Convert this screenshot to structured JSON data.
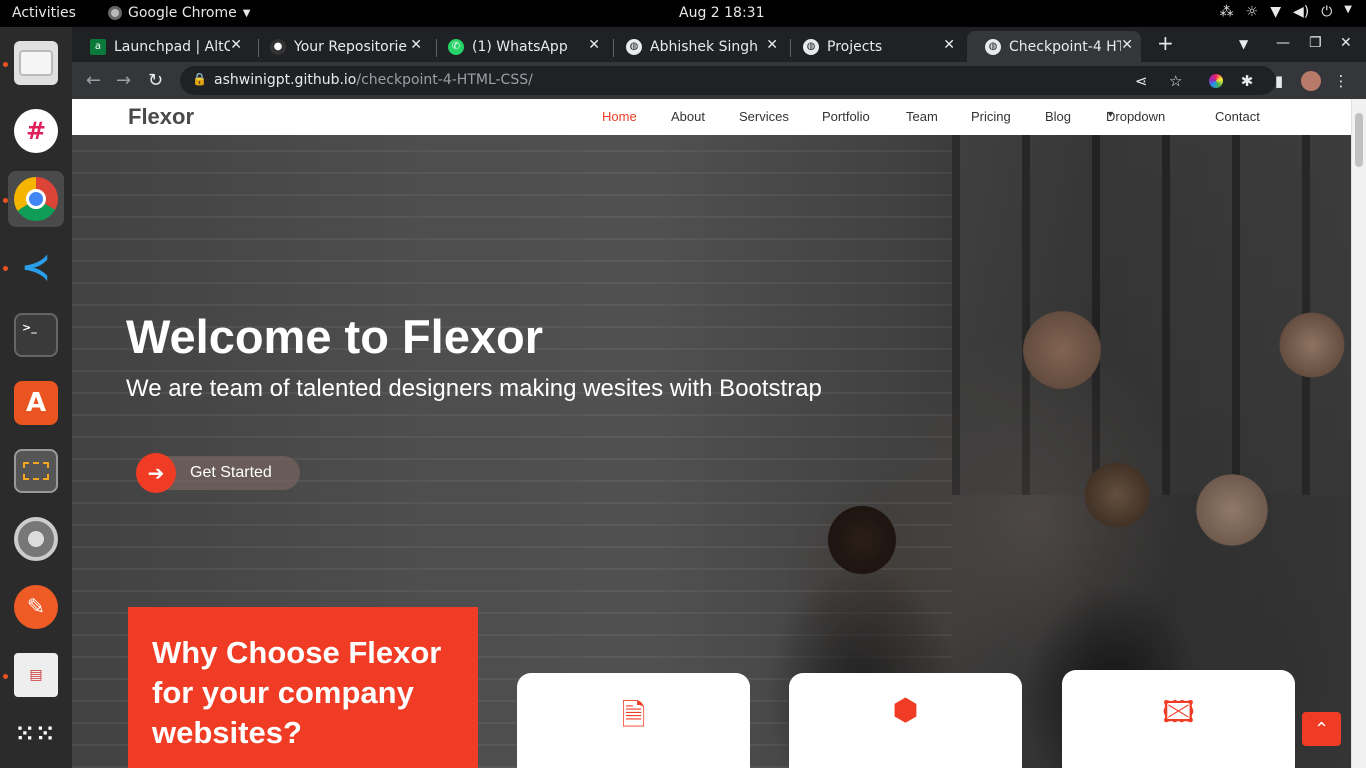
{
  "os": {
    "activities": "Activities",
    "app_name": "Google Chrome",
    "clock": "Aug 2  18:31"
  },
  "dock": {
    "apps": [
      "files-icon",
      "slack-icon",
      "chrome-icon",
      "vscode-icon",
      "terminal-icon",
      "software-store-icon",
      "screenshot-icon",
      "settings-icon",
      "postman-icon",
      "document-viewer-icon",
      "app-grid-icon"
    ]
  },
  "browser": {
    "tabs": [
      {
        "title": "Launchpad | AltC",
        "icon": "chart-icon"
      },
      {
        "title": "Your Repositorie",
        "icon": "github-icon"
      },
      {
        "title": "(1) WhatsApp",
        "icon": "whatsapp-icon"
      },
      {
        "title": "Abhishek Singh",
        "icon": "globe-icon"
      },
      {
        "title": "Projects",
        "icon": "globe-icon"
      },
      {
        "title": "Checkpoint-4 HT",
        "icon": "globe-icon"
      }
    ],
    "url_host": "ashwinigpt.github.io",
    "url_path": "/checkpoint-4-HTML-CSS/"
  },
  "site": {
    "logo": "Flexor",
    "nav": [
      "Home",
      "About",
      "Services",
      "Portfolio",
      "Team",
      "Pricing",
      "Blog",
      "Dropdown",
      "Contact"
    ],
    "active_nav": "Home",
    "hero_title": "Welcome to Flexor",
    "hero_subtitle": "We are team of talented designers making wesites with Bootstrap",
    "cta_label": "Get Started",
    "why_title": "Why Choose Flexor for your company websites?",
    "cards": [
      {
        "icon": "document-icon"
      },
      {
        "icon": "cube-icon"
      },
      {
        "icon": "images-icon"
      }
    ],
    "accent_color": "#f03c24"
  }
}
